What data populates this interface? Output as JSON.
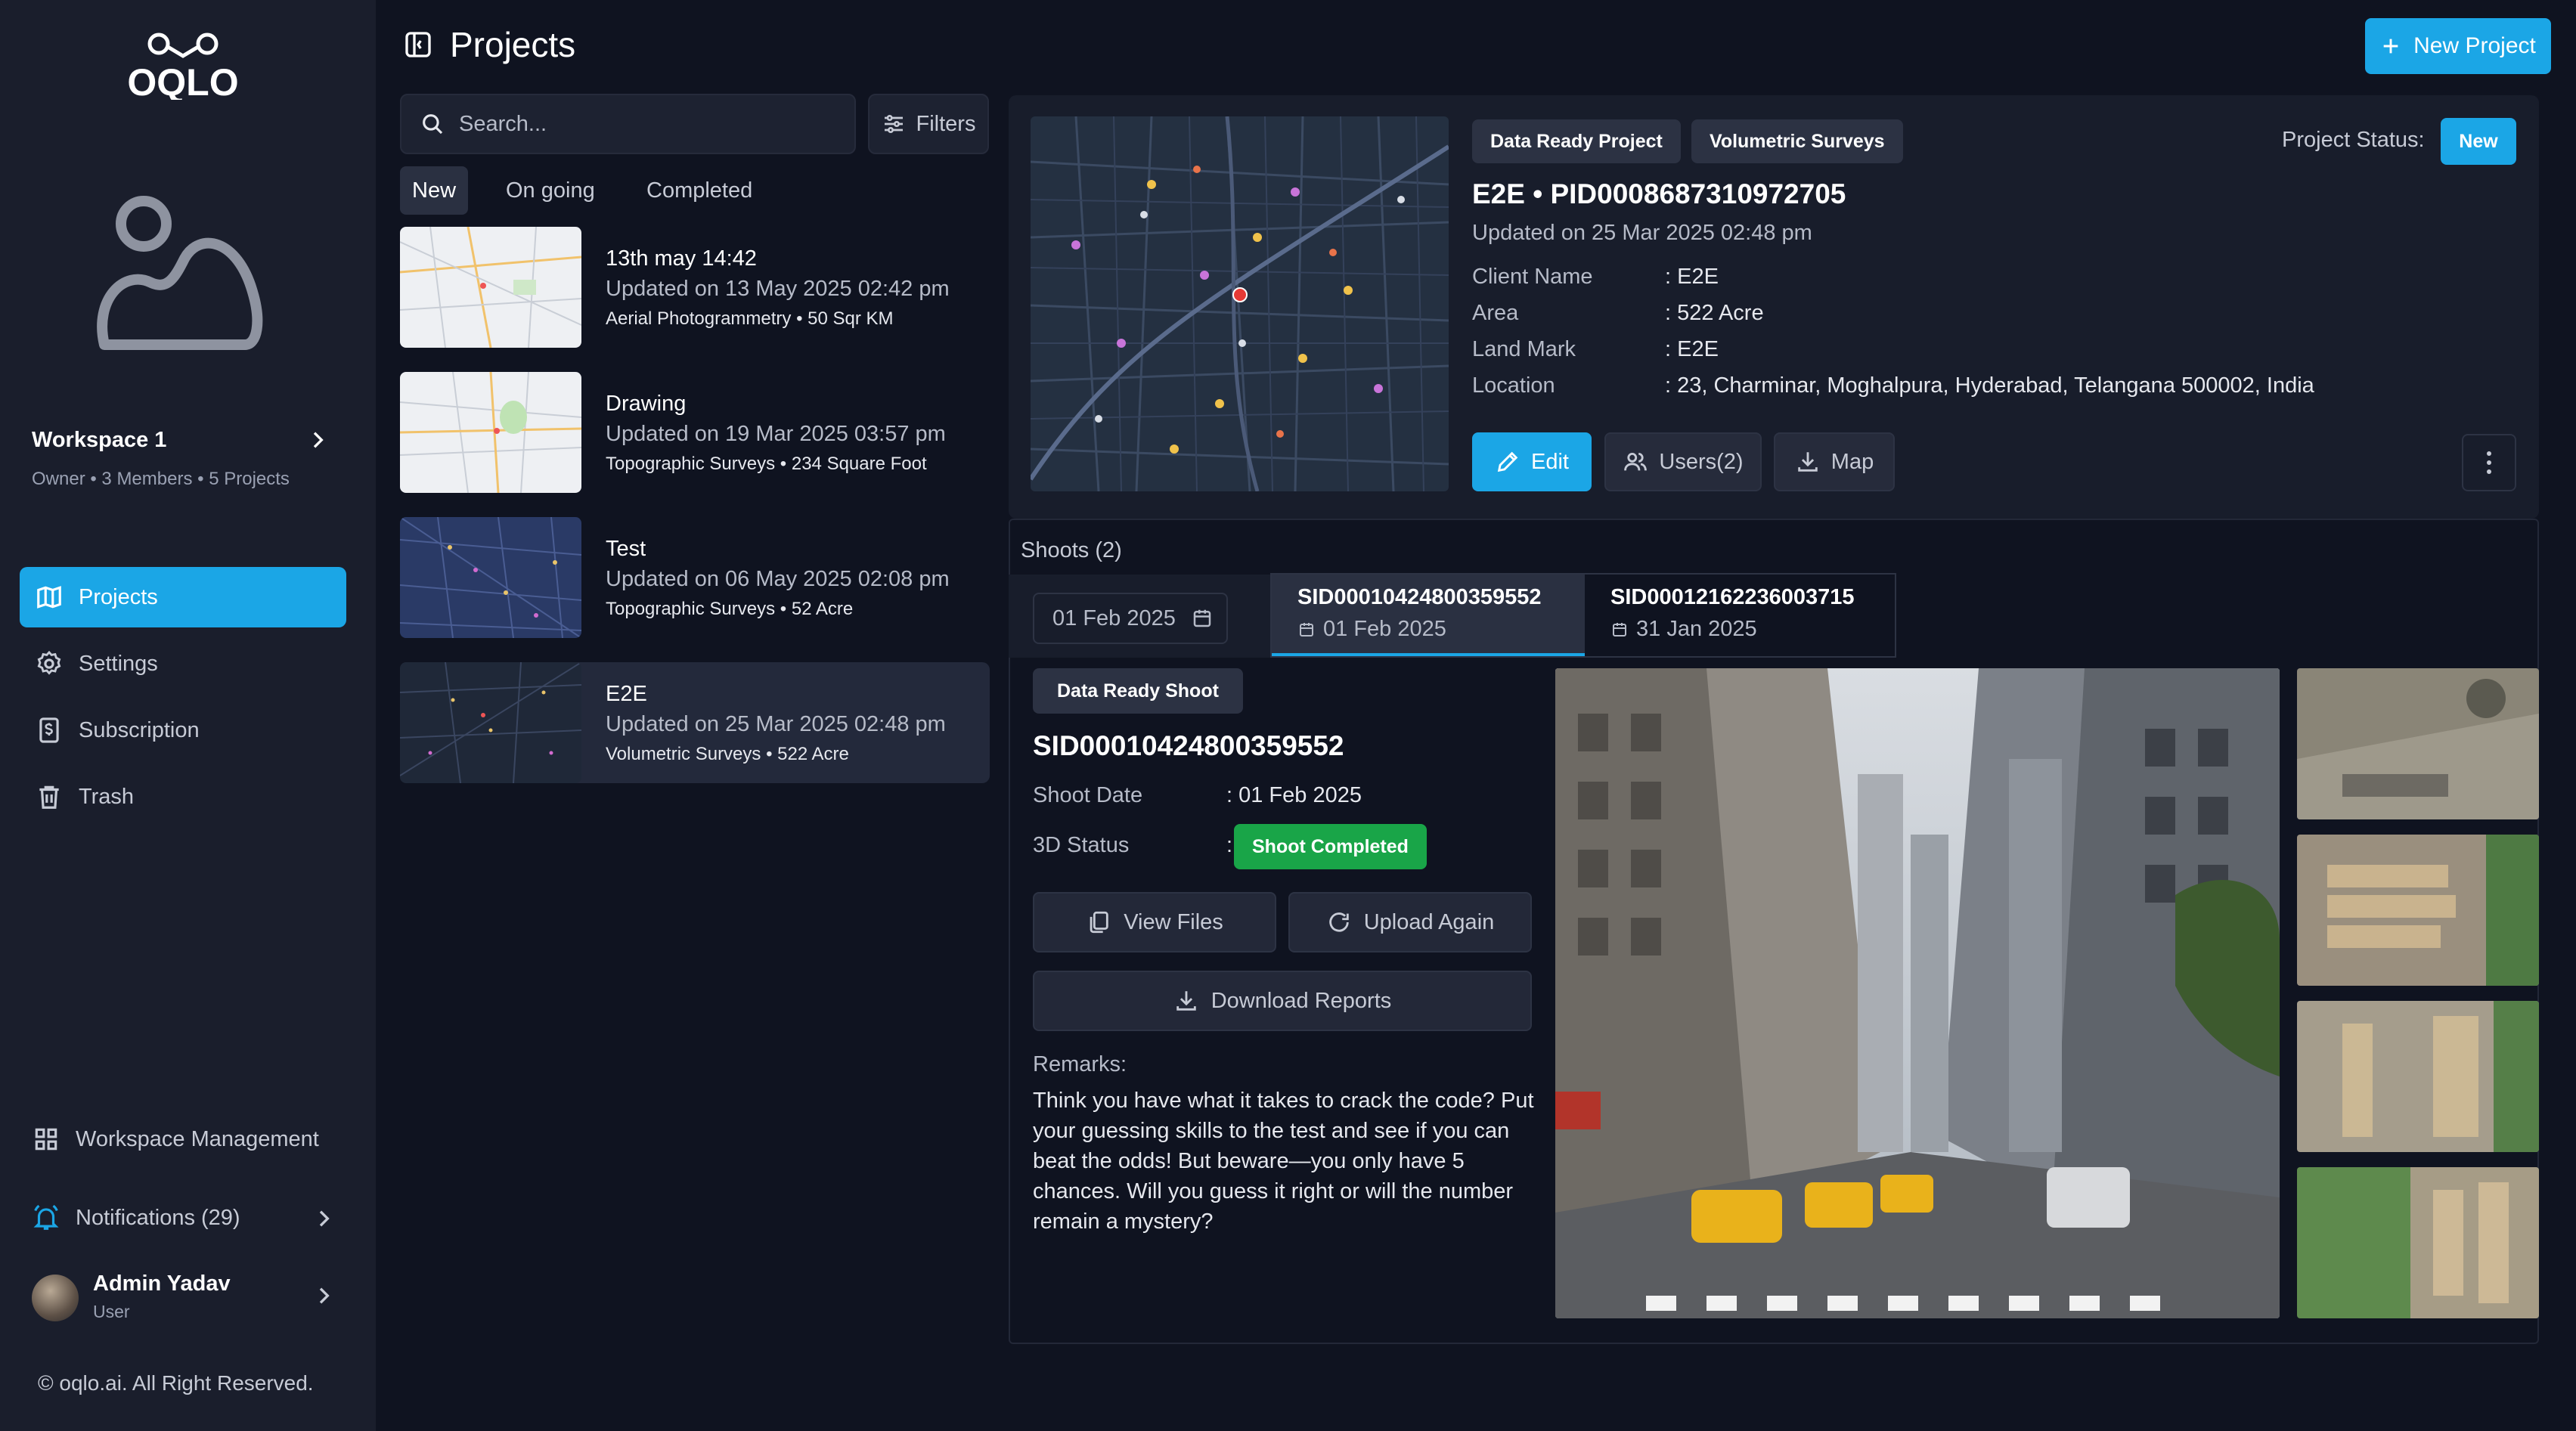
{
  "brand": {
    "logo_text": "OQLO"
  },
  "workspace": {
    "name": "Workspace 1",
    "meta": "Owner • 3 Members • 5 Projects"
  },
  "nav": {
    "projects": "Projects",
    "settings": "Settings",
    "subscription": "Subscription",
    "trash": "Trash",
    "workspace_management": "Workspace Management",
    "notifications": "Notifications (29)"
  },
  "user": {
    "name": "Admin Yadav",
    "role": "User"
  },
  "footer": {
    "copyright": "© oqlo.ai. All Right Reserved."
  },
  "header": {
    "title": "Projects",
    "new_project_label": "New Project"
  },
  "search": {
    "placeholder": "Search..."
  },
  "filters_label": "Filters",
  "tabs": [
    "New",
    "On going",
    "Completed"
  ],
  "projects": [
    {
      "name": "13th may 14:42",
      "updated": "Updated on 13 May 2025 02:42 pm",
      "meta": "Aerial Photogrammetry • 50 Sqr KM"
    },
    {
      "name": "Drawing",
      "updated": "Updated on 19 Mar 2025 03:57 pm",
      "meta": "Topographic Surveys • 234 Square Foot"
    },
    {
      "name": "Test",
      "updated": "Updated on 06 May 2025 02:08 pm",
      "meta": "Topographic Surveys • 52 Acre"
    },
    {
      "name": "E2E",
      "updated": "Updated on 25 Mar 2025 02:48 pm",
      "meta": "Volumetric Surveys • 522 Acre"
    }
  ],
  "detail": {
    "tags": [
      "Data Ready Project",
      "Volumetric Surveys"
    ],
    "status_label": "Project Status:",
    "status": "New",
    "title": "E2E • PID0008687310972705",
    "updated": "Updated on 25 Mar 2025 02:48 pm",
    "fields": [
      {
        "label": "Client Name",
        "value": ": E2E"
      },
      {
        "label": "Area",
        "value": ": 522 Acre"
      },
      {
        "label": "Land Mark",
        "value": ": E2E"
      },
      {
        "label": "Location",
        "value": ": 23, Charminar, Moghalpura, Hyderabad, Telangana 500002, India"
      }
    ],
    "actions": {
      "edit": "Edit",
      "users": "Users(2)",
      "map": "Map"
    }
  },
  "shoots": {
    "title": "Shoots (2)",
    "date_filter": "01 Feb 2025",
    "tabs": [
      {
        "id": "SID00010424800359552",
        "date": "01 Feb 2025"
      },
      {
        "id": "SID00012162236003715",
        "date": "31 Jan 2025"
      }
    ],
    "selected": {
      "tag": "Data Ready Shoot",
      "id": "SID00010424800359552",
      "shoot_date_label": "Shoot Date",
      "shoot_date_value": ": 01 Feb 2025",
      "status_label": "3D Status",
      "status_colon": ":",
      "status_value": "Shoot Completed",
      "view_files": "View Files",
      "upload_again": "Upload Again",
      "download_reports": "Download Reports",
      "remarks_label": "Remarks:",
      "remarks": "Think you have what it takes to crack the code? Put your guessing skills to the test and see if you can beat the odds! But beware—you only have 5 chances. Will you guess it right or will the number remain a mystery?"
    }
  },
  "colors": {
    "accent": "#1ba6e6",
    "success": "#19a548",
    "bg": "#0f1320",
    "sidebar": "#1a1e2c"
  }
}
